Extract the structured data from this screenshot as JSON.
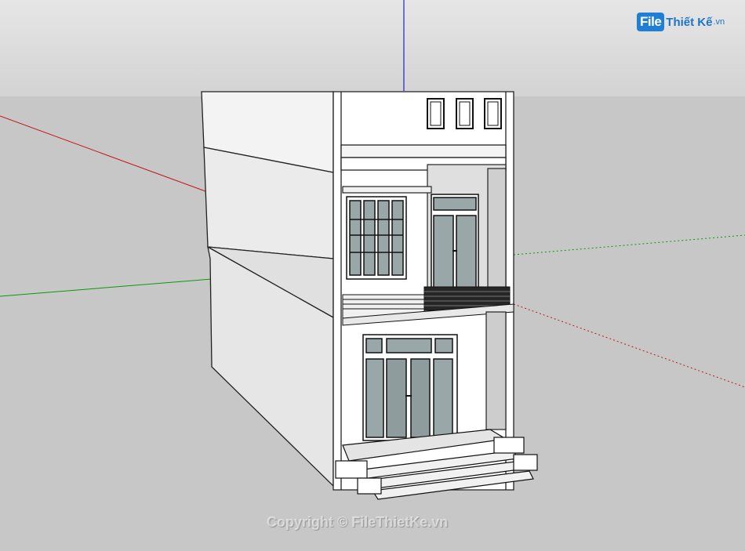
{
  "app": {
    "viewport": "3d-model-viewport"
  },
  "watermark": {
    "logo_file": "File",
    "logo_rest": "Thiết Kế",
    "logo_suffix": ".vn",
    "copyright": "Copyright © FileThietKe.vn"
  },
  "colors": {
    "sky": "#dcdcdc",
    "ground": "#c7c7c7",
    "axis_red": "#c4161c",
    "axis_green": "#0a9a0a",
    "axis_blue": "#1f1fd0",
    "wall_front": "#ffffff",
    "wall_side": "#e9e9e9",
    "glass": "#8fa0a2",
    "frame": "#111111"
  },
  "model": {
    "name": "two-storey-townhouse",
    "floors": 2,
    "roof_windows": 3,
    "balcony_railing": true,
    "entrance_steps": 3
  }
}
